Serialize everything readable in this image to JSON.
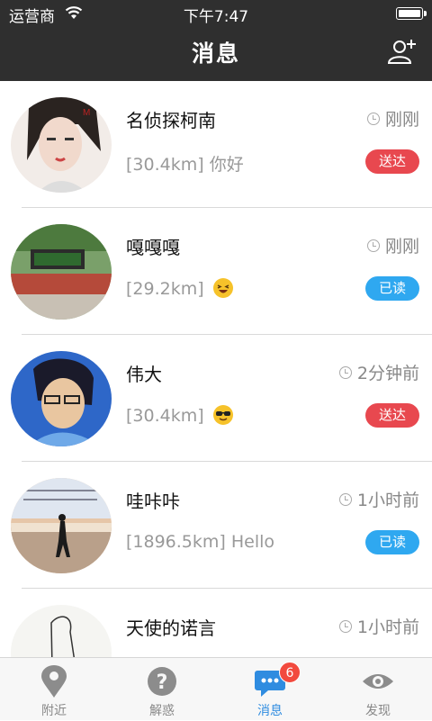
{
  "status_bar": {
    "carrier": "运营商",
    "time": "下午7:47"
  },
  "nav": {
    "title": "消息"
  },
  "messages": [
    {
      "name": "名侦探柯南",
      "time": "刚刚",
      "distance": "[30.4km]",
      "preview": "你好",
      "status": "送达",
      "status_type": "sent",
      "emoji": ""
    },
    {
      "name": "嘎嘎嘎",
      "time": "刚刚",
      "distance": "[29.2km]",
      "preview": "",
      "status": "已读",
      "status_type": "read",
      "emoji": "laughing-emoji"
    },
    {
      "name": "伟大",
      "time": "2分钟前",
      "distance": "[30.4km]",
      "preview": "",
      "status": "送达",
      "status_type": "sent",
      "emoji": "sunglasses-emoji"
    },
    {
      "name": "哇咔咔",
      "time": "1小时前",
      "distance": "[1896.5km]",
      "preview": "Hello",
      "status": "已读",
      "status_type": "read",
      "emoji": ""
    },
    {
      "name": "天使的诺言",
      "time": "1小时前",
      "distance": "",
      "preview": "",
      "status": "",
      "status_type": "read",
      "emoji": ""
    }
  ],
  "tabs": [
    {
      "label": "附近",
      "icon": "location-pin-icon"
    },
    {
      "label": "解惑",
      "icon": "question-icon"
    },
    {
      "label": "消息",
      "icon": "chat-bubble-icon",
      "active": true,
      "badge": "6"
    },
    {
      "label": "发现",
      "icon": "eye-icon"
    }
  ],
  "colors": {
    "nav_bg": "#2f2f2f",
    "sent": "#e8484f",
    "read": "#2fa8f0",
    "tab_active": "#2f8ce0"
  }
}
